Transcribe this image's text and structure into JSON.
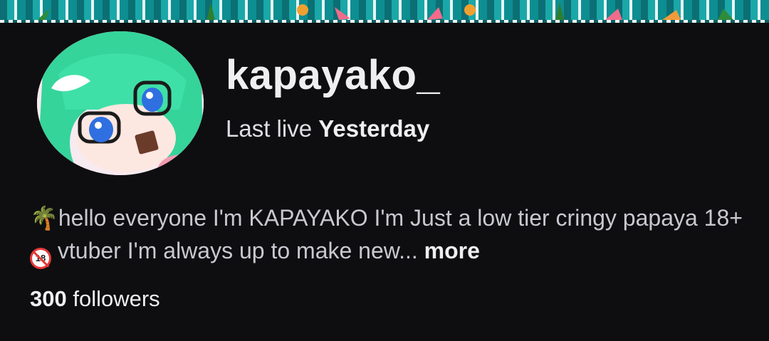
{
  "channel": {
    "name": "kapayako_",
    "last_live_prefix": "Last live",
    "last_live_value": "Yesterday"
  },
  "bio": {
    "line1_icon": "palm-tree-icon",
    "text_part1": "hello everyone I'm KAPAYAKO I'm Just a low tier cringy papaya 18+",
    "no_under_18_icon": "no-under-18-icon",
    "no_under_18_badge_text": "18",
    "text_part2": "vtuber I'm always up to make new...",
    "more_label": "more"
  },
  "followers": {
    "count": "300",
    "label": "followers"
  },
  "colors": {
    "background": "#0e0e10",
    "text_primary": "#efeff1",
    "text_secondary": "#c8c8cf",
    "banner_teal": "#0b6f74"
  }
}
